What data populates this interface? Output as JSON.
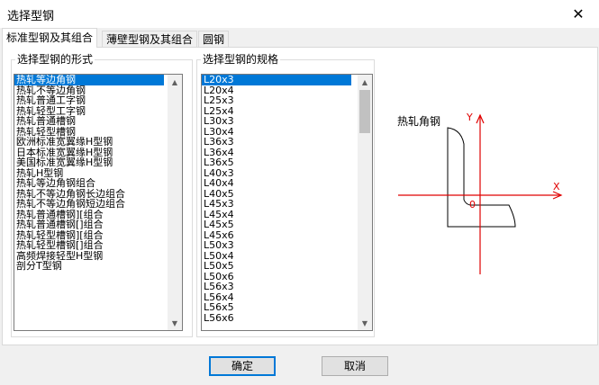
{
  "window": {
    "title": "选择型钢",
    "close_glyph": "✕"
  },
  "tabs": [
    {
      "label": "标准型钢及其组合",
      "active": true
    },
    {
      "label": "薄壁型钢及其组合",
      "active": false
    },
    {
      "label": "圆钢",
      "active": false
    }
  ],
  "form_group": {
    "label": "选择型钢的形式",
    "items": [
      "热轧等边角钢",
      "热轧不等边角钢",
      "热轧普通工字钢",
      "热轧轻型工字钢",
      "热轧普通槽钢",
      "热轧轻型槽钢",
      "欧洲标准宽翼缘H型钢",
      "日本标准宽翼缘H型钢",
      "美国标准宽翼缘H型钢",
      "热轧H型钢",
      "热轧等边角钢组合",
      "热轧不等边角钢长边组合",
      "热轧不等边角钢短边组合",
      "热轧普通槽钢][组合",
      "热轧普通槽钢[]组合",
      "热轧轻型槽钢][组合",
      "热轧轻型槽钢[]组合",
      "高频焊接轻型H型钢",
      "剖分T型钢"
    ],
    "selected_index": 0
  },
  "spec_group": {
    "label": "选择型钢的规格",
    "items": [
      "L20x3",
      "L20x4",
      "L25x3",
      "L25x4",
      "L30x3",
      "L30x4",
      "L36x3",
      "L36x4",
      "L36x5",
      "L40x3",
      "L40x4",
      "L40x5",
      "L45x3",
      "L45x4",
      "L45x5",
      "L45x6",
      "L50x3",
      "L50x4",
      "L50x5",
      "L50x6",
      "L56x3",
      "L56x4",
      "L56x5",
      "L56x6"
    ],
    "selected_index": 0,
    "scroll_position": 0.0
  },
  "preview": {
    "section_label": "热轧角钢",
    "axis_y": "Y",
    "axis_x": "X",
    "origin": "0",
    "axis_color": "#e00000"
  },
  "buttons": {
    "ok": "确定",
    "cancel": "取消"
  },
  "scroll_glyphs": {
    "up": "▲",
    "down": "▼"
  }
}
